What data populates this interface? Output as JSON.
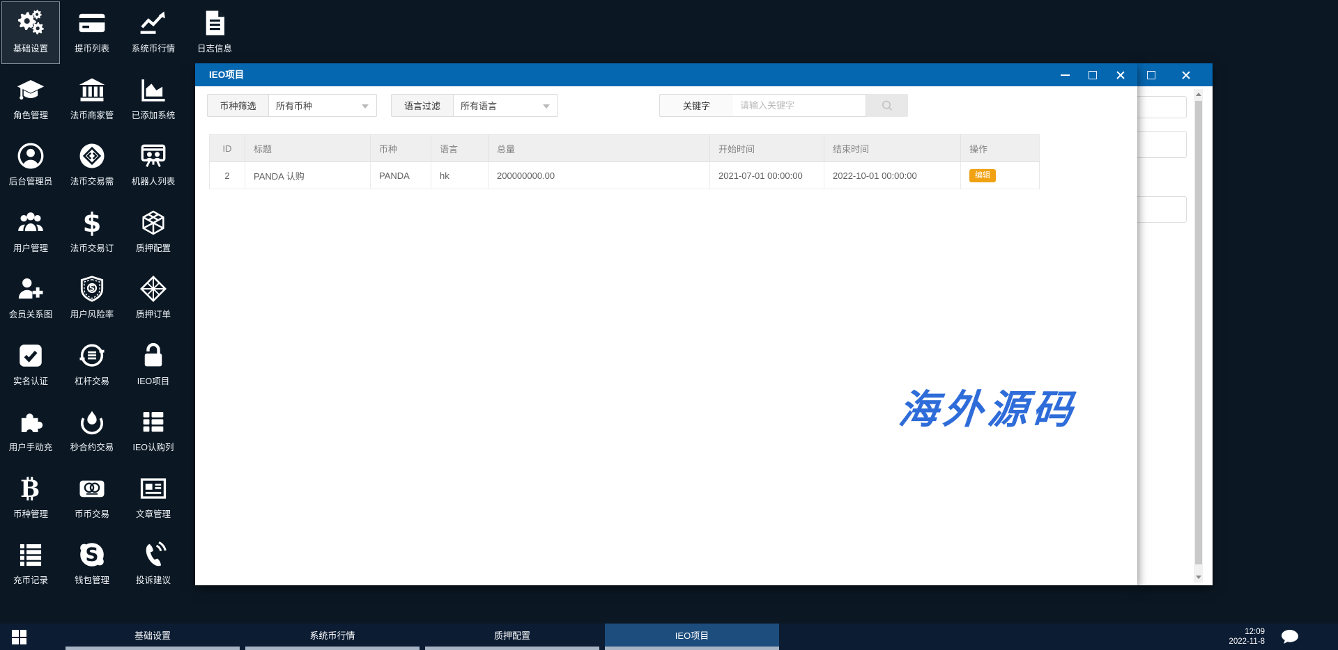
{
  "desktop": {
    "rows": [
      [
        {
          "label": "基础设置",
          "icon": "settings-gears-icon",
          "selected": true
        },
        {
          "label": "提币列表",
          "icon": "withdraw-card-icon"
        },
        {
          "label": "系统币行情",
          "icon": "trend-chart-icon"
        },
        {
          "label": "日志信息",
          "icon": "log-file-icon"
        }
      ],
      [
        {
          "label": "角色管理",
          "icon": "graduation-cap-icon"
        },
        {
          "label": "法币商家管",
          "icon": "bank-icon"
        },
        {
          "label": "已添加系统",
          "icon": "area-chart-icon"
        }
      ],
      [
        {
          "label": "后台管理员",
          "icon": "admin-user-icon"
        },
        {
          "label": "法币交易需",
          "icon": "exchange-diamond-icon"
        },
        {
          "label": "机器人列表",
          "icon": "robot-board-icon"
        }
      ],
      [
        {
          "label": "用户管理",
          "icon": "users-group-icon"
        },
        {
          "label": "法币交易订",
          "icon": "dollar-icon"
        },
        {
          "label": "质押配置",
          "icon": "cube-wireframe-icon"
        }
      ],
      [
        {
          "label": "会员关系图",
          "icon": "user-add-icon"
        },
        {
          "label": "用户风险率",
          "icon": "risk-shield-icon"
        },
        {
          "label": "质押订单",
          "icon": "diamond-lattice-icon"
        }
      ],
      [
        {
          "label": "实名认证",
          "icon": "check-square-icon"
        },
        {
          "label": "杠杆交易",
          "icon": "margin-coin-icon"
        },
        {
          "label": "IEO项目",
          "icon": "padlock-open-icon"
        }
      ],
      [
        {
          "label": "用户手动充",
          "icon": "puzzle-icon"
        },
        {
          "label": "秒合约交易",
          "icon": "rebel-emblem-icon"
        },
        {
          "label": "IEO认购列",
          "icon": "subscribe-list-icon"
        }
      ],
      [
        {
          "label": "币种管理",
          "icon": "bitcoin-icon"
        },
        {
          "label": "币币交易",
          "icon": "mastercard-icon"
        },
        {
          "label": "文章管理",
          "icon": "article-news-icon"
        }
      ],
      [
        {
          "label": "充币记录",
          "icon": "deposit-list-icon"
        },
        {
          "label": "钱包管理",
          "icon": "skype-wallet-icon"
        },
        {
          "label": "投诉建议",
          "icon": "phone-feedback-icon"
        }
      ]
    ]
  },
  "modal": {
    "title": "IEO项目",
    "filters": {
      "currency_label": "币种筛选",
      "currency_value": "所有币种",
      "language_label": "语言过滤",
      "language_value": "所有语言",
      "keyword_label": "关键字",
      "keyword_placeholder": "请输入关键字"
    },
    "table": {
      "headers": [
        "ID",
        "标题",
        "币种",
        "语言",
        "总量",
        "开始时间",
        "结束时间",
        "操作"
      ],
      "rows": [
        [
          "2",
          "PANDA 认购",
          "PANDA",
          "hk",
          "200000000.00",
          "2021-07-01 00:00:00",
          "2022-10-01 00:00:00",
          "编辑"
        ]
      ]
    }
  },
  "watermark": "海外源码",
  "taskbar": {
    "items": [
      {
        "label": "基础设置",
        "active": false
      },
      {
        "label": "系统币行情",
        "active": false
      },
      {
        "label": "质押配置",
        "active": false
      },
      {
        "label": "IEO项目",
        "active": true
      }
    ],
    "time": "12:09",
    "date": "2022-11-8"
  },
  "colors": {
    "titlebar_blue": "#0667b1",
    "taskbar_navy": "#0b1c33",
    "active_tab_blue": "#1d4d7d",
    "edit_button_orange": "#f0a213",
    "watermark_blue": "#2e6cd9",
    "desktop_navy": "#0b1824"
  }
}
